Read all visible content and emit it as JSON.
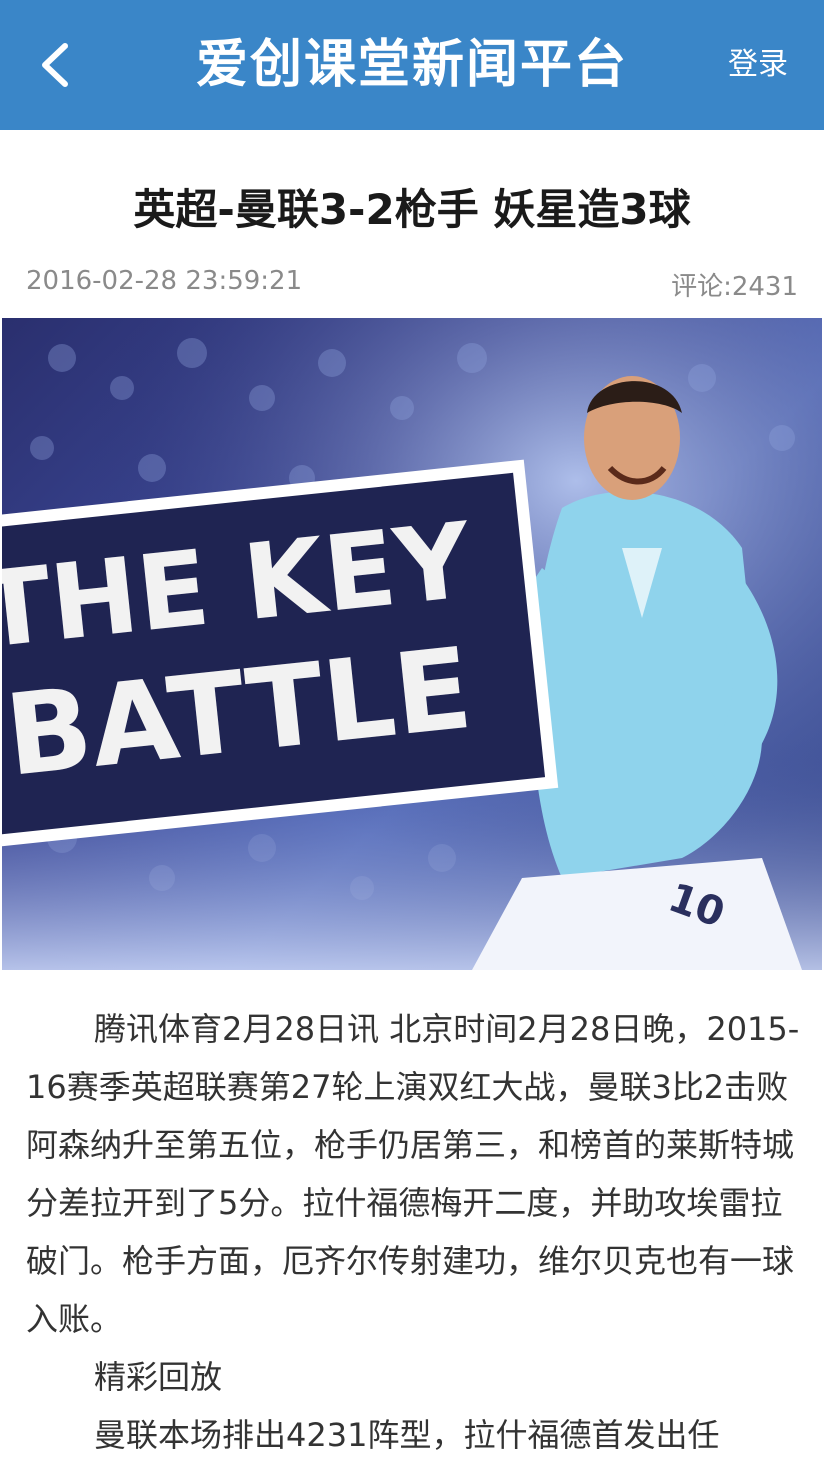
{
  "header": {
    "title": "爱创课堂新闻平台",
    "login_label": "登录",
    "back_icon": "chevron-left-icon"
  },
  "article": {
    "title": "英超-曼联3-2枪手 妖星造3球",
    "date": "2016-02-28 23:59:21",
    "comments": "评论:2431",
    "image": {
      "banner_line1": "THE KEY",
      "banner_line2": "BATTLE",
      "jersey_number": "10"
    },
    "paragraph1": "腾讯体育2月28日讯 北京时间2月28日晚，2015-16赛季英超联赛第27轮上演双红大战，曼联3比2击败阿森纳升至第五位，枪手仍居第三，和榜首的莱斯特城分差拉开到了5分。拉什福德梅开二度，并助攻埃雷拉破门。枪手方面，厄齐尔传射建功，维尔贝克也有一球入账。",
    "section_label": "精彩回放",
    "paragraph2": "曼联本场排出4231阵型，拉什福德首发出任"
  },
  "colors": {
    "header_bg": "#3a86c8",
    "title_text": "#1a1a1a",
    "meta_text": "#8a8a8a",
    "body_text": "#333333"
  }
}
